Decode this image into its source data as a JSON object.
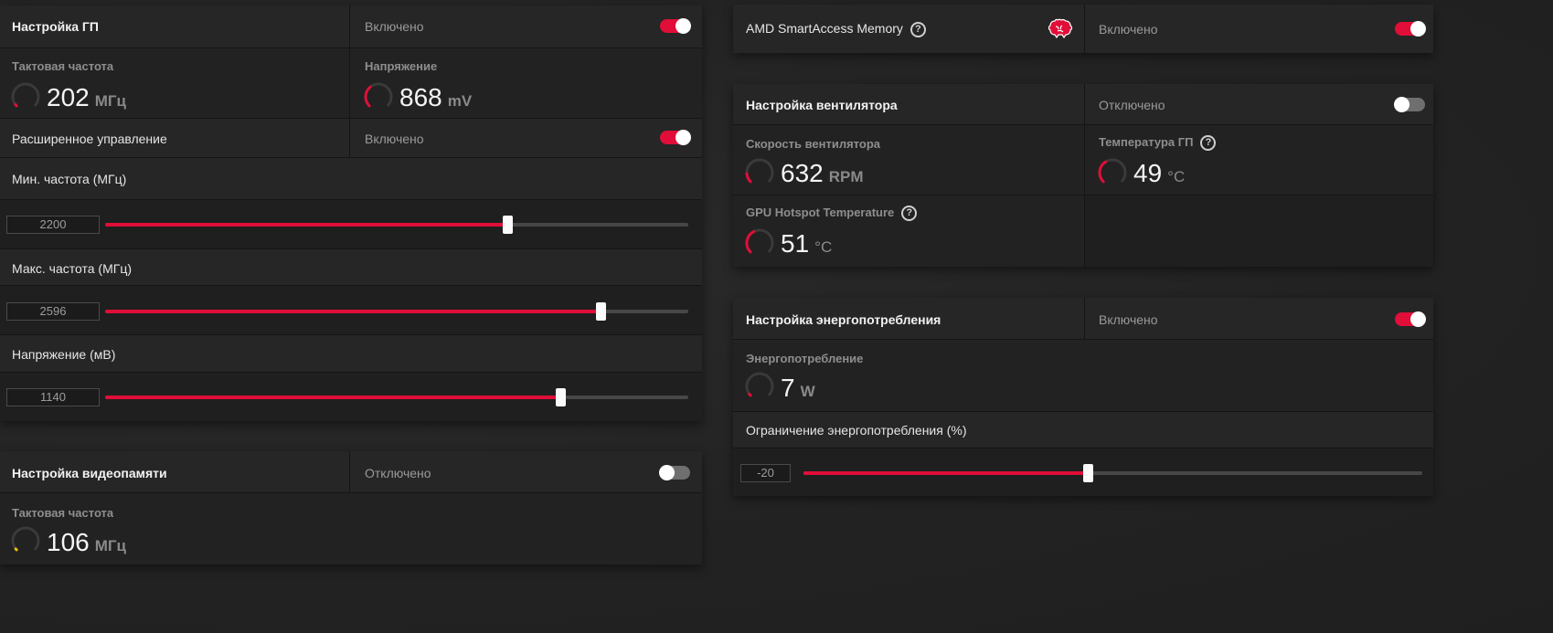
{
  "gpu": {
    "title": "Настройка ГП",
    "state": "Включено",
    "clock": {
      "label": "Тактовая частота",
      "value": "202",
      "unit": "МГц",
      "level": 0.03
    },
    "voltage": {
      "label": "Напряжение",
      "value": "868",
      "unit": "mV",
      "level": 0.35
    },
    "advanced": {
      "label": "Расширенное управление",
      "state": "Включено"
    },
    "min_freq": {
      "label": "Мин. частота (МГц)",
      "value": "2200",
      "level": 0.69
    },
    "max_freq": {
      "label": "Макс. частота (МГц)",
      "value": "2596",
      "level": 0.85
    },
    "volt_slider": {
      "label": "Напряжение (мВ)",
      "value": "1140",
      "level": 0.78
    }
  },
  "vram": {
    "title": "Настройка видеопамяти",
    "state": "Отключено",
    "clock": {
      "label": "Тактовая частота",
      "value": "106",
      "unit": "МГц",
      "level": 0.02
    }
  },
  "sam": {
    "title": "AMD SmartAccess Memory",
    "help": "?",
    "state": "Включено"
  },
  "fan": {
    "title": "Настройка вентилятора",
    "state": "Отключено",
    "speed": {
      "label": "Скорость вентилятора",
      "value": "632",
      "unit": "RPM",
      "level": 0.15
    },
    "temp": {
      "label": "Температура ГП",
      "help": "?",
      "value": "49",
      "unit": "°C",
      "level": 0.38
    },
    "hotspot": {
      "label": "GPU Hotspot Temperature",
      "help": "?",
      "value": "51",
      "unit": "°C",
      "level": 0.4
    }
  },
  "power": {
    "title": "Настройка энергопотребления",
    "state": "Включено",
    "usage": {
      "label": "Энергопотребление",
      "value": "7",
      "unit": "W",
      "level": 0.03
    },
    "limit": {
      "label": "Ограничение энергопотребления (%)",
      "value": "-20",
      "level": 0.46
    }
  },
  "colors": {
    "accent": "#e00e38",
    "panel": "#262626",
    "panel_dark": "#1f1f1f",
    "gauge_track": "#3a3a3a",
    "vram_gauge": "#f2c200"
  },
  "icons": {
    "brain": "brain-icon",
    "help": "help-circle-icon"
  }
}
